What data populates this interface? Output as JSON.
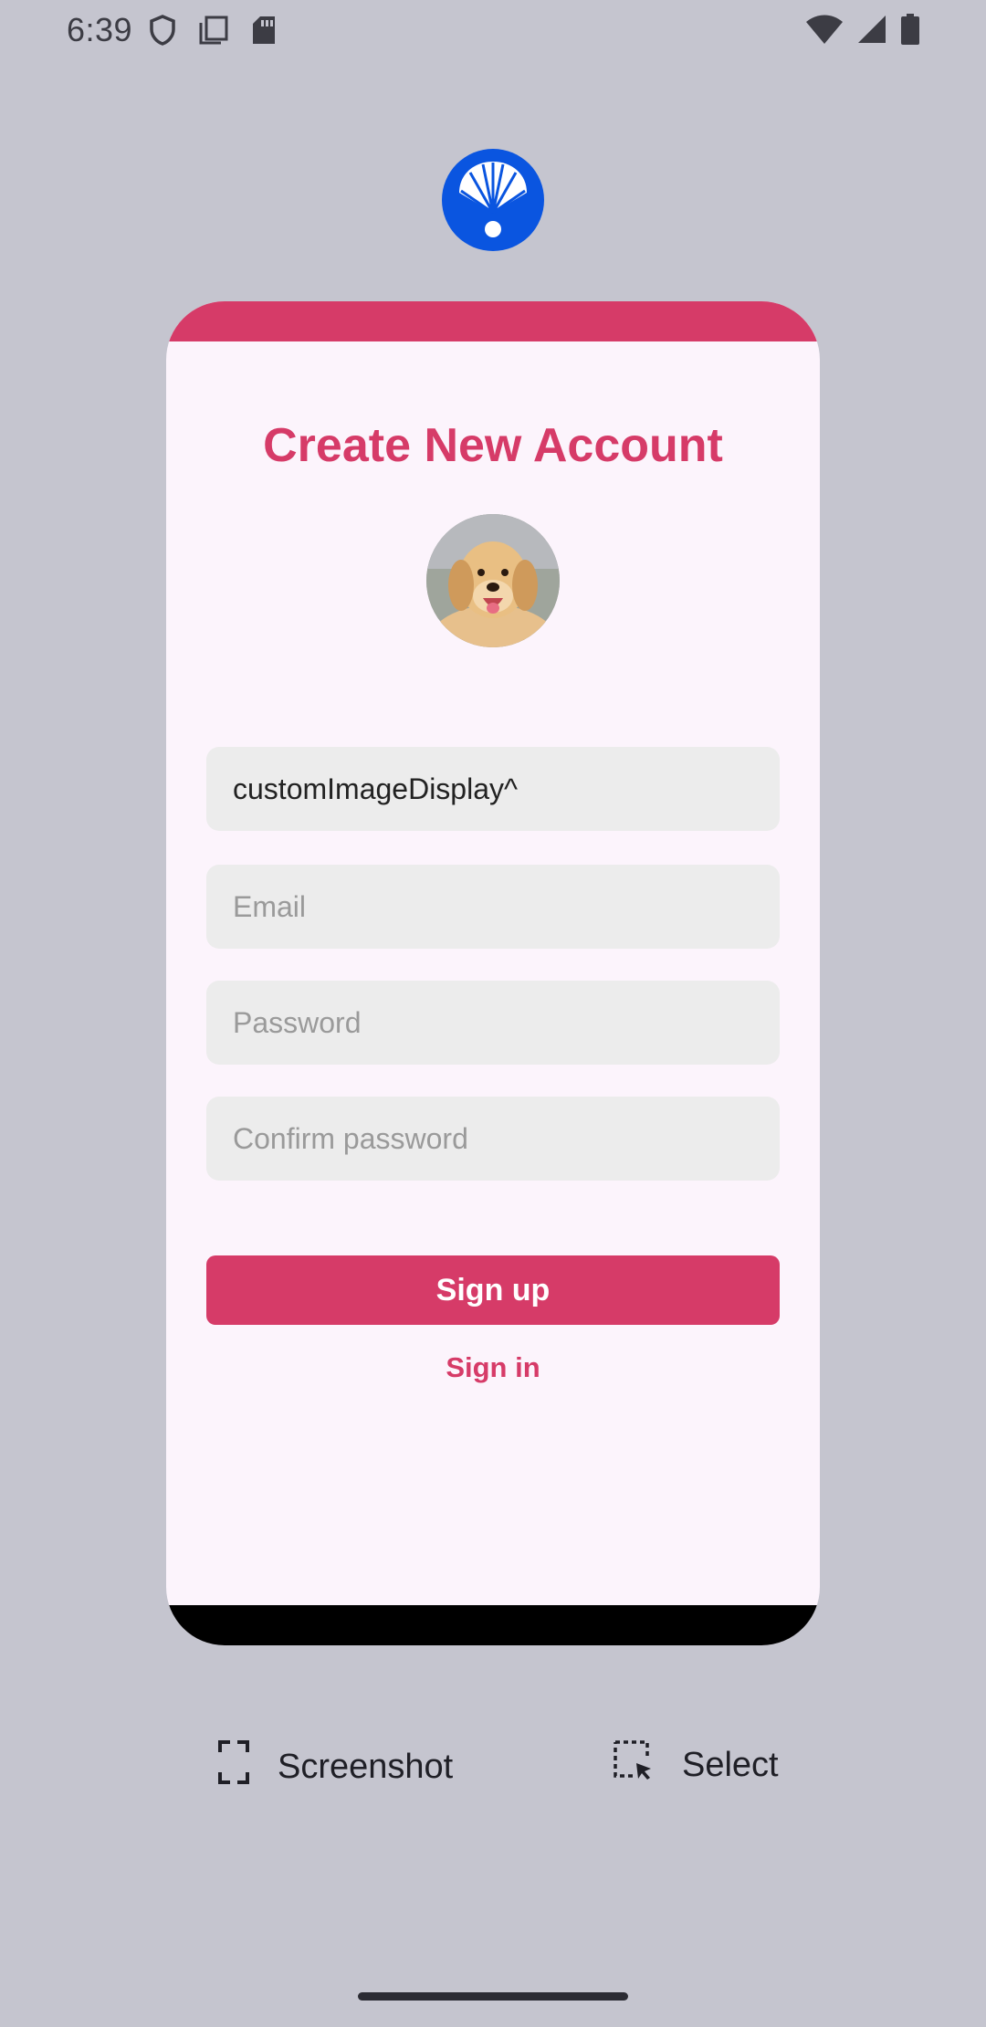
{
  "status_bar": {
    "time": "6:39",
    "left_icons": [
      "shield-icon",
      "copy-icon",
      "sd-card-icon"
    ],
    "right_icons": [
      "wifi-icon",
      "cellular-icon",
      "battery-icon"
    ]
  },
  "app": {
    "logo_icon": "shell-icon",
    "accent_color": "#d63b68",
    "logo_color": "#0a55e0"
  },
  "card": {
    "title": "Create New Account",
    "avatar_icon": "dog-avatar",
    "fields": {
      "username": {
        "value": "customImageDisplay^",
        "placeholder": ""
      },
      "email": {
        "value": "",
        "placeholder": "Email"
      },
      "password": {
        "value": "",
        "placeholder": "Password"
      },
      "confirm_password": {
        "value": "",
        "placeholder": "Confirm password"
      }
    },
    "signup_label": "Sign up",
    "signin_label": "Sign in"
  },
  "actions": {
    "screenshot_label": "Screenshot",
    "select_label": "Select"
  }
}
